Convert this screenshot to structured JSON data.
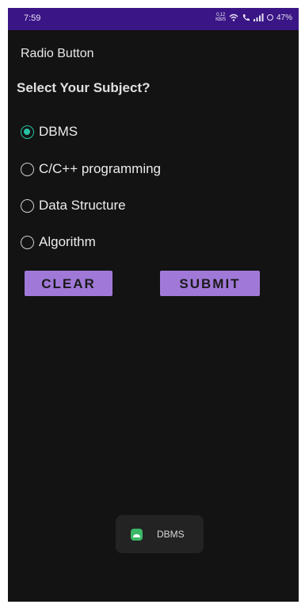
{
  "status_bar": {
    "time": "7:59",
    "net_speed_top": "0.12",
    "net_speed_bottom": "KB/S",
    "battery": "47%",
    "icons": [
      "wifi-icon",
      "call-icon",
      "signal-icon",
      "battery-ring-icon"
    ]
  },
  "app": {
    "title": "Radio Button",
    "question": "Select Your Subject?"
  },
  "radio_options": [
    {
      "label": "DBMS",
      "checked": true
    },
    {
      "label": "C/C++ programming",
      "checked": false
    },
    {
      "label": "Data Structure",
      "checked": false
    },
    {
      "label": "Algorithm",
      "checked": false
    }
  ],
  "buttons": {
    "clear_label": "CLEAR",
    "submit_label": "SUBMIT"
  },
  "toast": {
    "icon": "app-icon",
    "text": "DBMS"
  },
  "colors": {
    "status_bar": "#3a1585",
    "background": "#131313",
    "accent_radio": "#27c2a3",
    "button": "#a079d8"
  }
}
